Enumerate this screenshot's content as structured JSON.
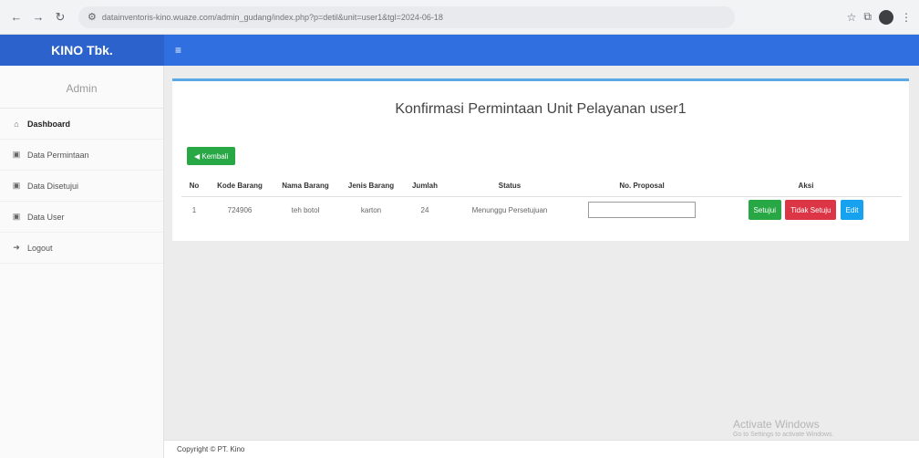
{
  "browser": {
    "url": "datainventoris-kino.wuaze.com/admin_gudang/index.php?p=detil&unit=user1&tgl=2024-06-18",
    "icons": [
      "back-icon",
      "forward-icon",
      "reload-icon",
      "site-settings-icon",
      "star-icon",
      "extensions-icon",
      "profile-icon",
      "menu-icon"
    ]
  },
  "app": {
    "brand": "KINO Tbk.",
    "menu_toggle": "≡",
    "accent_color": "#2f6fe0"
  },
  "sidebar": {
    "role": "Admin",
    "items": [
      {
        "label": "Dashboard",
        "icon": "home-icon",
        "glyph": "⌂"
      },
      {
        "label": "Data Permintaan",
        "icon": "clipboard-icon",
        "glyph": "▣"
      },
      {
        "label": "Data Disetujui",
        "icon": "clipboard-check-icon",
        "glyph": "▣"
      },
      {
        "label": "Data User",
        "icon": "user-icon",
        "glyph": "▣"
      },
      {
        "label": "Logout",
        "icon": "logout-icon",
        "glyph": "➜"
      }
    ]
  },
  "main": {
    "title": "Konfirmasi Permintaan Unit Pelayanan user1",
    "back_label": "◀ Kembali",
    "table": {
      "headers": [
        "No",
        "Kode Barang",
        "Nama Barang",
        "Jenis Barang",
        "Jumlah",
        "Status",
        "No. Proposal",
        "Aksi"
      ],
      "rows": [
        {
          "no": "1",
          "kode": "724906",
          "nama": "teh botol",
          "jenis": "karton",
          "jumlah": "24",
          "status": "Menunggu Persetujuan",
          "proposal_value": "",
          "actions": [
            "Setujui",
            "Tidak Setuju",
            "Edit"
          ]
        }
      ]
    }
  },
  "footer": {
    "copyright": "Copyright © PT. Kino"
  },
  "watermark": {
    "line1": "Activate Windows",
    "line2": "Go to Settings to activate Windows."
  }
}
